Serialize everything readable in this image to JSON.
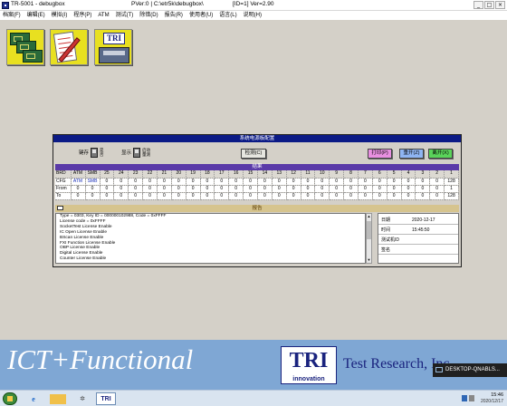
{
  "titlebar": {
    "app_title": "TR-5001 - debugbox",
    "pver": "PVer:0 | C:\\etr5k\\debugbox\\",
    "id_ver": "[ID=1] Ver=2.90",
    "controls": [
      "_",
      "□",
      "×"
    ]
  },
  "menu": [
    "档案(F)",
    "编辑(E)",
    "模拟(I)",
    "程序(P)",
    "ATM",
    "测试(T)",
    "除错(D)",
    "报告(R)",
    "使用者(U)",
    "语言(L)",
    "说明(H)"
  ],
  "tools": [
    {
      "name": "pcb-layout-tool",
      "icon": "pcb-boards-icon"
    },
    {
      "name": "program-edit-tool",
      "icon": "paper-pen-icon"
    },
    {
      "name": "tri-test-tool",
      "icon": "tri-machine-icon",
      "label": "TRI"
    }
  ],
  "dialog": {
    "title": "系统电源板配置",
    "toggle1": {
      "label": "键存",
      "options": [
        "是",
        "否"
      ]
    },
    "toggle2": {
      "label": "显示",
      "options": [
        "启动",
        "量测"
      ]
    },
    "check_button": "检测(C)",
    "print_button": "打印(P)",
    "clear_button": "重开(Z)",
    "exit_button": "离开(X)",
    "result_header": "结果",
    "grid": {
      "header": [
        "BRD",
        "ATM",
        "SMB",
        "25",
        "24",
        "23",
        "22",
        "21",
        "20",
        "19",
        "18",
        "17",
        "16",
        "15",
        "14",
        "13",
        "12",
        "11",
        "10",
        "9",
        "8",
        "7",
        "6",
        "5",
        "4",
        "3",
        "2",
        "1"
      ],
      "cfg": [
        "CFG",
        "ATM",
        "SMB",
        "0",
        "0",
        "0",
        "0",
        "0",
        "0",
        "0",
        "0",
        "0",
        "0",
        "0",
        "0",
        "0",
        "0",
        "0",
        "0",
        "0",
        "0",
        "0",
        "0",
        "0",
        "0",
        "0",
        "0",
        "128"
      ],
      "from": [
        "From",
        "0",
        "0",
        "0",
        "0",
        "0",
        "0",
        "0",
        "0",
        "0",
        "0",
        "0",
        "0",
        "0",
        "0",
        "0",
        "0",
        "0",
        "0",
        "0",
        "0",
        "0",
        "0",
        "0",
        "0",
        "0",
        "0",
        "1"
      ],
      "to": [
        "To",
        "0",
        "0",
        "0",
        "0",
        "0",
        "0",
        "0",
        "0",
        "0",
        "0",
        "0",
        "0",
        "0",
        "0",
        "0",
        "0",
        "0",
        "0",
        "0",
        "0",
        "0",
        "0",
        "0",
        "0",
        "0",
        "0",
        "128"
      ]
    },
    "report_header": "报告",
    "report_lines": [
      "Type = 0303, Key ID = 000000102988, Code = 0xFFFF",
      "License code = 0xFFFF",
      "SocketTest License Enable",
      "IC Open    License Enable",
      "BScan      License Enable",
      "FXI Function License Enable",
      " OBP       License Enable",
      "Digital    License Enable",
      "Counter    License Enable"
    ],
    "info": {
      "date_label": "日期",
      "date_value": "2020-12-17",
      "time_label": "时间",
      "time_value": "15:45:50",
      "tester_label": "测试机ID",
      "tester_value": "",
      "sign_label": "签名",
      "sign_value": ""
    }
  },
  "banner": {
    "ict_text": "ICT+Functional",
    "logo_text": "TRI",
    "logo_sub": "innovation",
    "company": "Test Research, Inc."
  },
  "taskbar": {
    "tri_label": "TRI",
    "time": "15:46",
    "date": "2020/12/17"
  },
  "toast": "DESKTOP-QNABLS..."
}
